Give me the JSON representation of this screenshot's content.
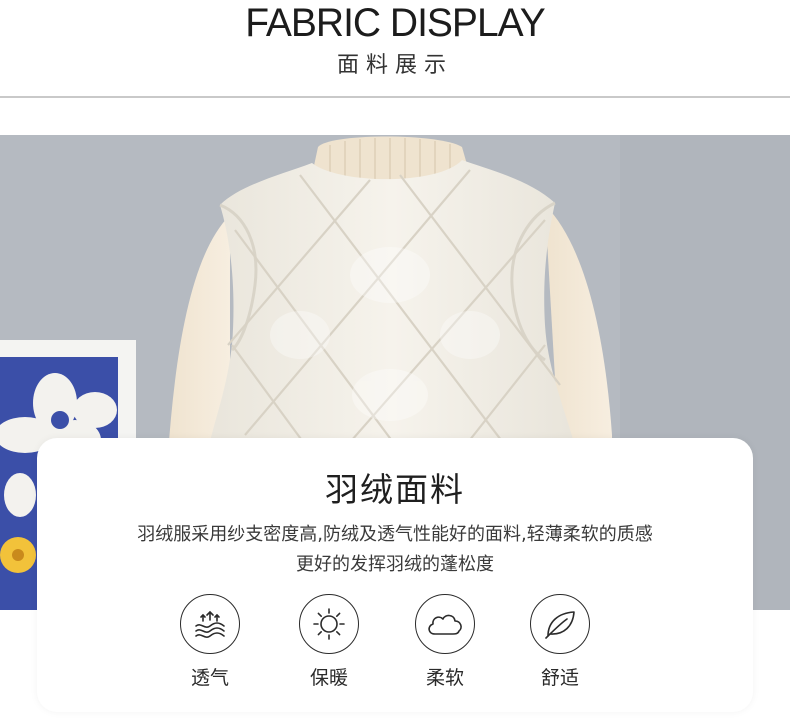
{
  "header": {
    "title": "FABRIC DISPLAY",
    "subtitle": "面料展示"
  },
  "card": {
    "title": "羽绒面料",
    "description_line1": "羽绒服采用纱支密度高,防绒及透气性能好的面料,轻薄柔软的质感",
    "description_line2": "更好的发挥羽绒的蓬松度"
  },
  "features": [
    {
      "label": "透气",
      "icon": "breathable-icon"
    },
    {
      "label": "保暖",
      "icon": "sun-icon"
    },
    {
      "label": "柔软",
      "icon": "cloud-icon"
    },
    {
      "label": "舒适",
      "icon": "leaf-icon"
    }
  ],
  "colors": {
    "background": "#ffffff",
    "wall": "#b4b9c0",
    "vest": "#f3f0e8",
    "sweater": "#f3e8d6",
    "text": "#1f1f1f"
  }
}
